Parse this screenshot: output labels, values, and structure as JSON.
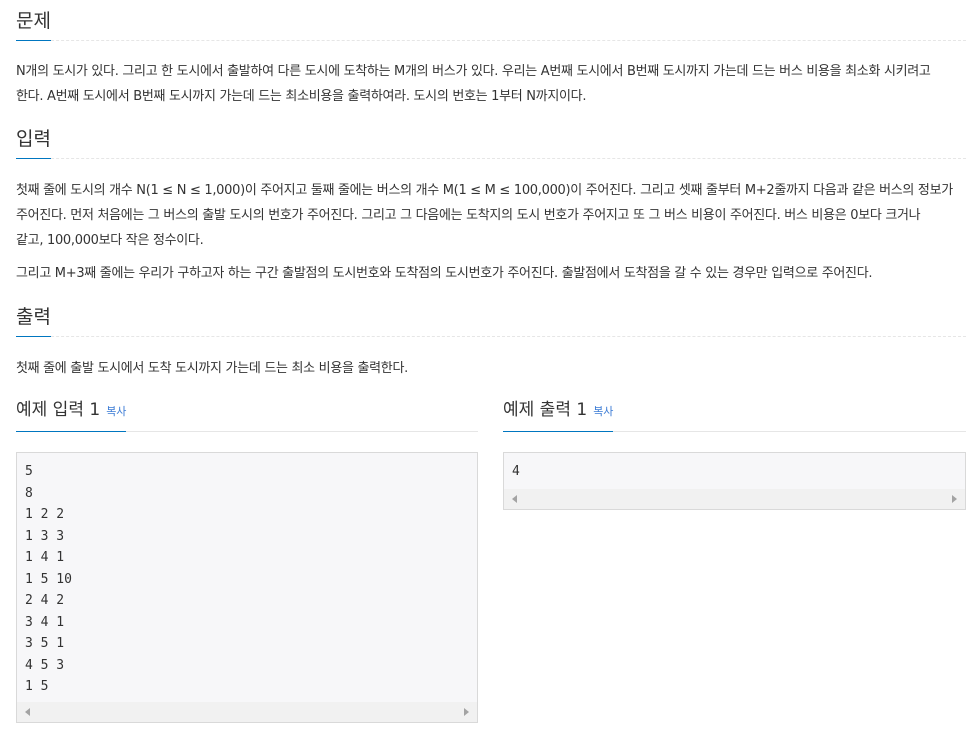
{
  "problem": {
    "heading": "문제",
    "description_line1": "N개의 도시가 있다. 그리고 한 도시에서 출발하여 다른 도시에 도착하는 M개의 버스가 있다. 우리는 A번째 도시에서 B번째 도시까지 가는데 드는 버스 비용을 최소화 시키려고",
    "description_line2": "한다. A번째 도시에서 B번째 도시까지 가는데 드는 최소비용을 출력하여라. 도시의 번호는 1부터 N까지이다."
  },
  "input": {
    "heading": "입력",
    "para1_line1": "첫째 줄에 도시의 개수 N(1 ≤ N ≤ 1,000)이 주어지고 둘째 줄에는 버스의 개수 M(1 ≤ M ≤ 100,000)이 주어진다. 그리고 셋째 줄부터 M+2줄까지 다음과 같은 버스의 정보가",
    "para1_line2": "주어진다. 먼저 처음에는 그 버스의 출발 도시의 번호가 주어진다. 그리고 그 다음에는 도착지의 도시 번호가 주어지고 또 그 버스 비용이 주어진다. 버스 비용은 0보다 크거나",
    "para1_line3": "같고, 100,000보다 작은 정수이다.",
    "para2": "그리고 M+3째 줄에는 우리가 구하고자 하는 구간 출발점의 도시번호와 도착점의 도시번호가 주어진다. 출발점에서 도착점을 갈 수 있는 경우만 입력으로 주어진다."
  },
  "output": {
    "heading": "출력",
    "description": "첫째 줄에 출발 도시에서 도착 도시까지 가는데 드는 최소 비용을 출력한다."
  },
  "sample_input": {
    "heading": "예제 입력 1",
    "copy_label": "복사",
    "content": "5\n8\n1 2 2\n1 3 3\n1 4 1\n1 5 10\n2 4 2\n3 4 1\n3 5 1\n4 5 3\n1 5"
  },
  "sample_output": {
    "heading": "예제 출력 1",
    "copy_label": "복사",
    "content": "4"
  },
  "icons": [
    "scroll-left-arrow-icon",
    "scroll-right-arrow-icon"
  ],
  "colors": {
    "accent": "#0076c0",
    "copy_link": "#3a7bd5",
    "pre_bg": "#f7f7f9"
  }
}
